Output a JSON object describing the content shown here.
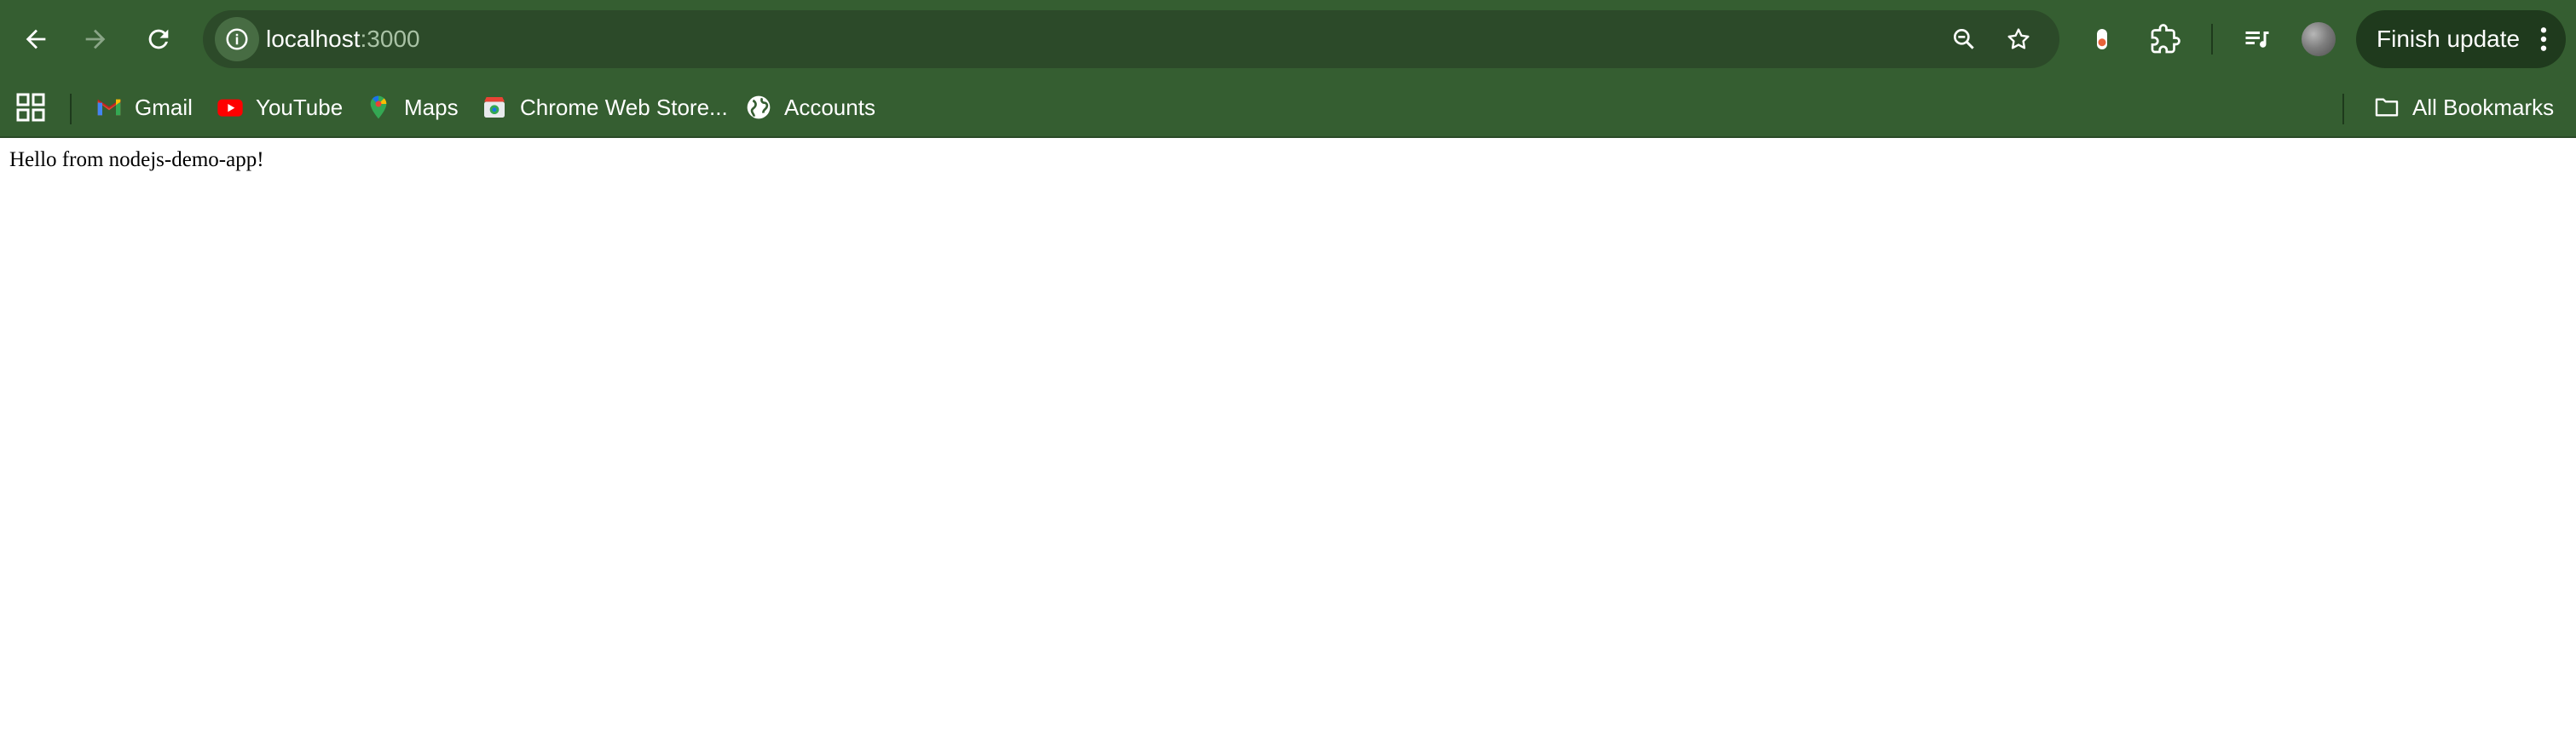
{
  "browser": {
    "address_bar": {
      "host": "localhost",
      "port": ":3000"
    },
    "finish_update_label": "Finish update"
  },
  "bookmarks": [
    {
      "label": "Gmail",
      "icon": "gmail-icon"
    },
    {
      "label": "YouTube",
      "icon": "youtube-icon"
    },
    {
      "label": "Maps",
      "icon": "maps-icon"
    },
    {
      "label": "Chrome Web Store...",
      "icon": "chrome-web-store-icon"
    },
    {
      "label": "Accounts",
      "icon": "globe-icon"
    }
  ],
  "all_bookmarks_label": "All Bookmarks",
  "page": {
    "text": "Hello from nodejs-demo-app!"
  },
  "colors": {
    "toolbar_bg": "#355e31",
    "omnibox_bg": "#2c4a29",
    "finish_update_bg": "#1f3a1d",
    "page_bg": "#ffffff"
  }
}
